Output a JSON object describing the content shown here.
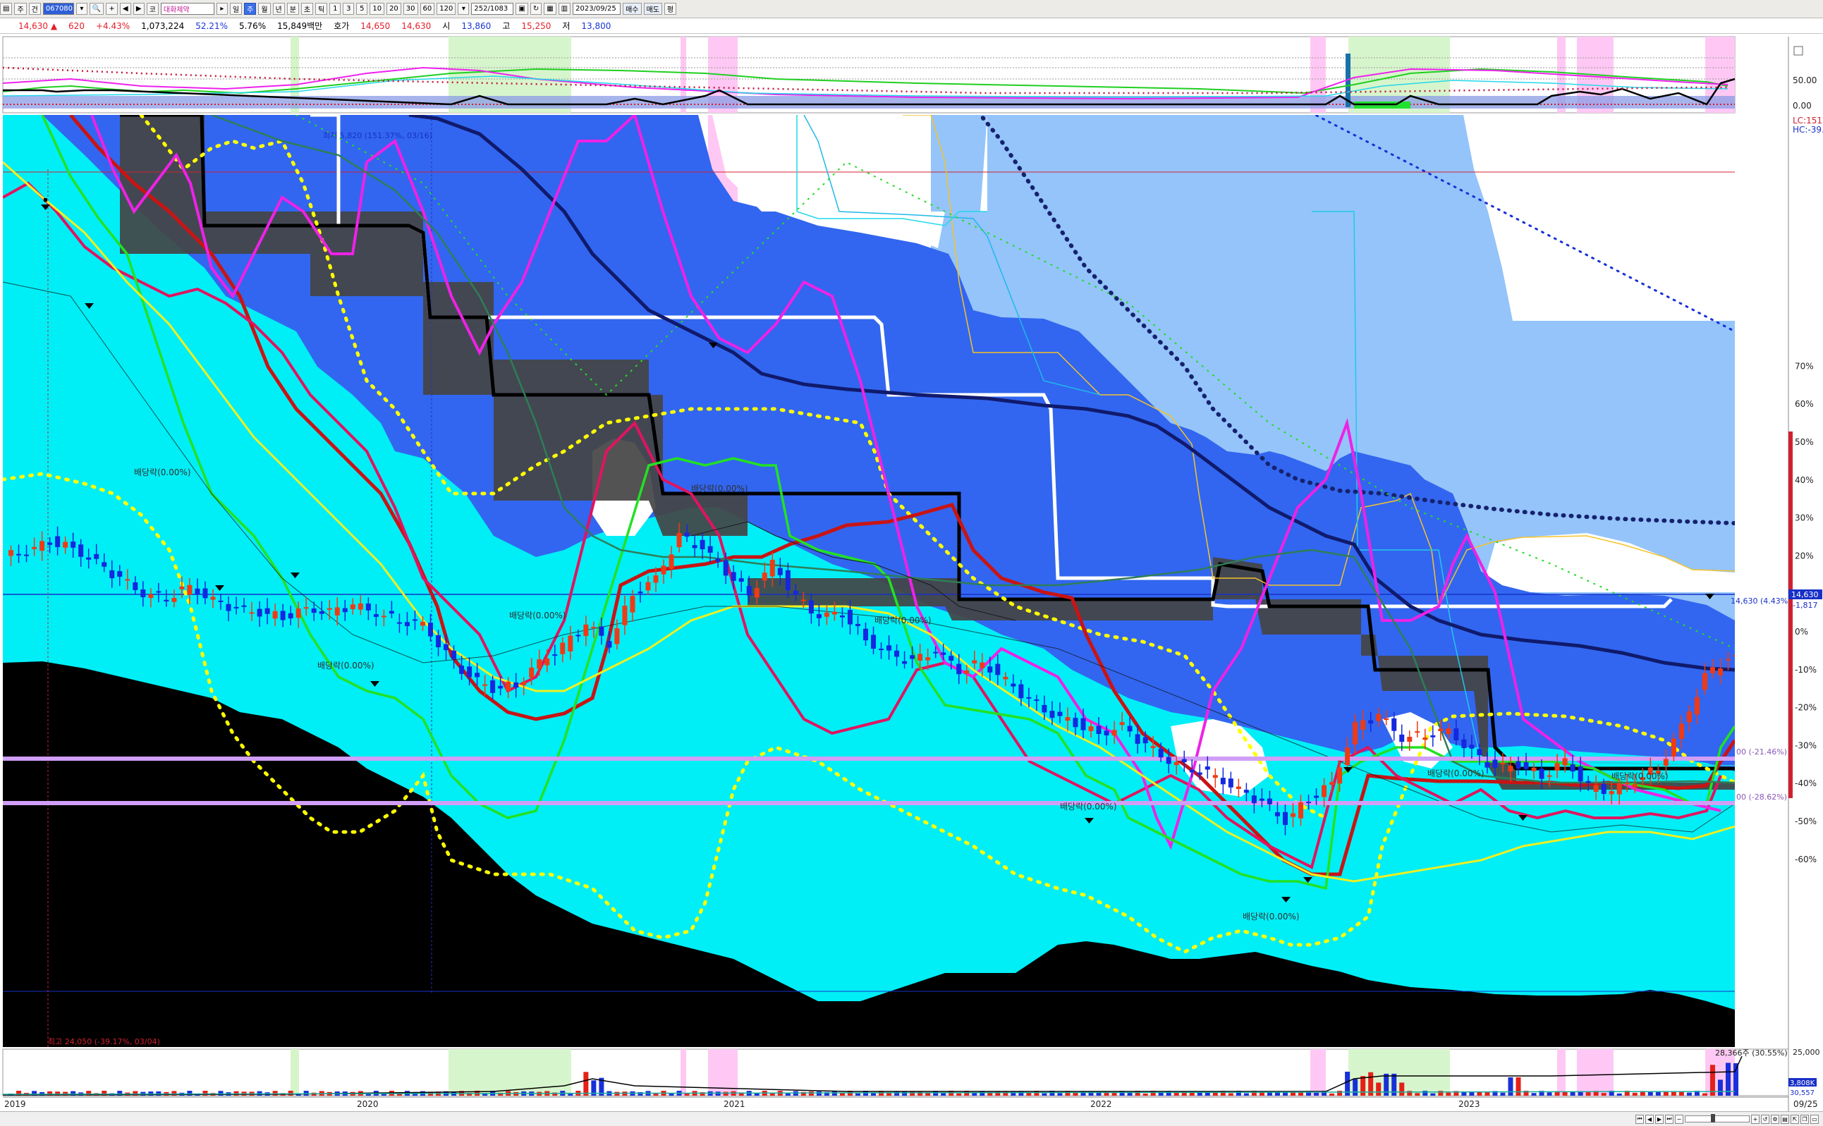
{
  "toolbar": {
    "period_buttons": [
      "주",
      "건"
    ],
    "code": "067080",
    "name": "대화제약",
    "periods": [
      "일",
      "주",
      "월",
      "년",
      "분",
      "초",
      "틱"
    ],
    "active_period": "주",
    "intervals": [
      "1",
      "3",
      "5",
      "10",
      "20",
      "30",
      "60",
      "120"
    ],
    "count": "252/1083",
    "date": "2023/09/25",
    "buy_label": "매수",
    "sell_label": "매도",
    "extra_label": "평"
  },
  "quote": {
    "price": "14,630",
    "change": "620",
    "change_pct": "+4.43%",
    "volume": "1,073,224",
    "vol_ratio": "52.21%",
    "turnover": "5.76%",
    "amount": "15,849백만",
    "ask_label": "호가",
    "ask": "14,650",
    "bid": "14,630",
    "open_label": "시",
    "open": "13,860",
    "high_label": "고",
    "high": "15,250",
    "low_label": "저",
    "low": "13,800"
  },
  "chart_data": [
    {
      "type": "line",
      "name": "oscillator-top",
      "y_ticks": [
        "50.00",
        "0.00"
      ]
    },
    {
      "type": "candlestick",
      "name": "price-main",
      "x_labels": [
        "2019",
        "2020",
        "2021",
        "2022",
        "2023"
      ],
      "y_ticks": [
        "70%",
        "60%",
        "50%",
        "40%",
        "30%",
        "20%",
        "10%",
        "0%",
        "-10%",
        "-20%",
        "-30%",
        "-40%",
        "-50%",
        "-60%"
      ],
      "current_price_label": "14,630 (4.43%)",
      "current_tag": "14,630",
      "current_sub": "-1,817",
      "upper_tag_1": "LC:151",
      "upper_tag_2": "HC:-39.",
      "annotation_top": "최저 5,820 (151.37%, 03/16)",
      "annotation_bottom": "최고 24,050 (-39.17%, 03/04)",
      "line_a_label": "00 (-21.46%)",
      "line_b_label": "00 (-28.62%)",
      "dividend_labels": [
        "배당락(0.00%)",
        "배당락(0.00%)",
        "배당락(0.00%)",
        "배당락(0.00%)",
        "배당락(0.00%)",
        "배당락(0.00%)",
        "배당락(0.00%)",
        "배당락(0.00%)",
        "배당락(0.00%)"
      ],
      "close_series": [
        20,
        21,
        24,
        22,
        18,
        14,
        10,
        9,
        12,
        8,
        6,
        5,
        4,
        6,
        5,
        7,
        5,
        3,
        2,
        -6,
        -12,
        -15,
        -14,
        -8,
        -4,
        2,
        -3,
        10,
        14,
        25,
        22,
        16,
        10,
        18,
        9,
        4,
        5,
        -2,
        -6,
        -8,
        -5,
        -10,
        -8,
        -13,
        -18,
        -22,
        -24,
        -27,
        -25,
        -30,
        -34,
        -36,
        -38,
        -42,
        -45,
        -50,
        -44,
        -40,
        -25,
        -22,
        -28,
        -27,
        -26,
        -32,
        -36,
        -35,
        -38,
        -34,
        -41,
        -42,
        -39,
        -36,
        -25,
        -12,
        -7
      ]
    },
    {
      "type": "bar",
      "name": "volume",
      "x_labels": [
        "2019",
        "2020",
        "2021",
        "2022",
        "2023",
        "09/25"
      ],
      "y_ticks": [
        "25,000"
      ],
      "max_label": "28,366주 (30.55%)",
      "vol_tag": "3,808K",
      "vol_tag_2": "30,557"
    }
  ]
}
